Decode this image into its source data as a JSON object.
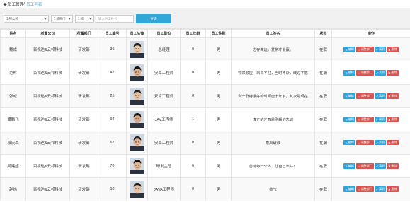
{
  "breadcrumb": {
    "root": "员工管理",
    "sep": "/",
    "current": "员工列表"
  },
  "filters": {
    "company": "全部公司",
    "department": "全部部门",
    "gender": "全部",
    "keyword_placeholder": "输入员工姓名",
    "query_label": "查询"
  },
  "table": {
    "headers": [
      "姓名",
      "所属公司",
      "所属部门",
      "员工编号",
      "员工头像",
      "员工职位",
      "员工年龄",
      "员工性别",
      "员工签名",
      "状态",
      "操作"
    ],
    "rows": [
      {
        "name": "戴成",
        "company": "百视达&云祁科技",
        "dept": "研发部",
        "no": "36",
        "position": "总经理",
        "age": "0",
        "gender": "男",
        "sign": "志存高远，爱拼才会赢。",
        "status": "在职"
      },
      {
        "name": "范林",
        "company": "百视达&云祁科技",
        "dept": "研发部",
        "no": "42",
        "position": "安卓工程师",
        "age": "0",
        "gender": "男",
        "sign": "物来顺应，未来不迎，当时不杂，既过不恋",
        "status": "在职"
      },
      {
        "name": "张威",
        "company": "百视达&云祁科技",
        "dept": "研发部",
        "no": "25",
        "position": "安卓工程师",
        "age": "0",
        "gender": "男",
        "sign": "和一群特最好的时间唐十年前，其次是现在",
        "status": "在职"
      },
      {
        "name": "潘鹏飞",
        "company": "百视达&云祁科技",
        "dept": "研发部",
        "no": "94",
        "position": "JAV工程师",
        "age": "1",
        "gender": "男",
        "sign": "真正的才智是刚毅的忠诚",
        "status": "在职"
      },
      {
        "name": "段庆森",
        "company": "百视达&云祁科技",
        "dept": "研发部",
        "no": "67",
        "position": "安卓工程师",
        "age": "0",
        "gender": "男",
        "sign": "乘风破浪",
        "status": "在职"
      },
      {
        "name": "吴建超",
        "company": "百视达&云祁科技",
        "dept": "研发部",
        "no": "70",
        "position": "研发主管",
        "age": "0",
        "gender": "男",
        "sign": "善待每一个人，让自己表好！",
        "status": "在职"
      },
      {
        "name": "赵炜",
        "company": "百视达&云祁科技",
        "dept": "研发部",
        "no": "10",
        "position": "JAVA工程师",
        "age": "0",
        "gender": "男",
        "sign": "帅气",
        "status": "在职"
      }
    ],
    "actions": {
      "edit": "编辑",
      "move": "调整部门",
      "quit": "离职",
      "delete": "删除"
    }
  },
  "colors": {
    "accent": "#31a6d9",
    "danger": "#d9534f",
    "filter_bg": "#f1f1f1"
  },
  "icons": [
    "home-icon",
    "edit-icon",
    "move-icon",
    "quit-icon",
    "delete-icon",
    "avatar-photo"
  ]
}
